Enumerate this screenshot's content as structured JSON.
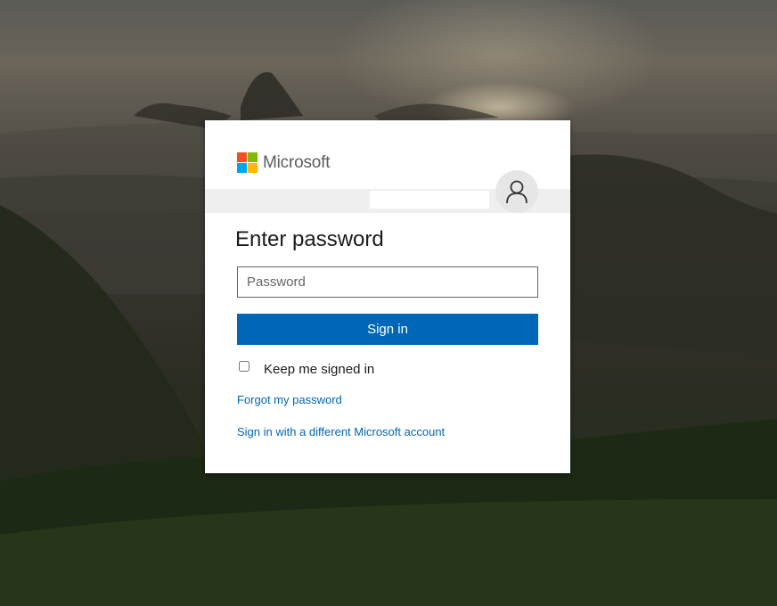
{
  "brand": {
    "name": "Microsoft",
    "logo_colors": [
      "#f25022",
      "#7fba00",
      "#00a4ef",
      "#ffb900"
    ]
  },
  "identity": {
    "email": "",
    "avatar_icon": "user-icon"
  },
  "form": {
    "title": "Enter password",
    "password_placeholder": "Password",
    "password_value": "",
    "signin_label": "Sign in",
    "keep_signed_in_label": "Keep me signed in",
    "keep_signed_in_checked": false
  },
  "links": {
    "forgot_password": "Forgot my password",
    "different_account": "Sign in with a different Microsoft account"
  },
  "colors": {
    "accent": "#0067b8",
    "card_background": "#ffffff",
    "identity_band": "#efefef"
  }
}
